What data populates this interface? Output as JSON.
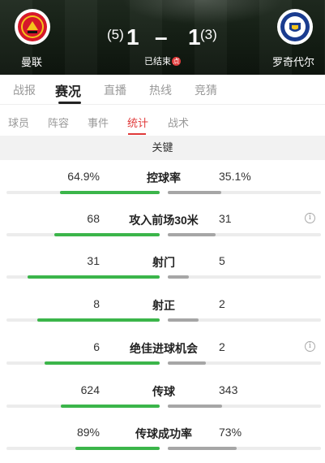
{
  "match": {
    "home": {
      "name": "曼联",
      "goals": "1",
      "penalties": "(5)"
    },
    "away": {
      "name": "罗奇代尔",
      "goals": "1",
      "penalties": "(3)"
    },
    "dash": "–",
    "status": "已结束",
    "status_badge": "点"
  },
  "tabs": [
    {
      "label": "战报",
      "active": false
    },
    {
      "label": "赛况",
      "active": true
    },
    {
      "label": "直播",
      "active": false
    },
    {
      "label": "热线",
      "active": false
    },
    {
      "label": "竞猜",
      "active": false
    }
  ],
  "subtabs": [
    {
      "label": "球员",
      "active": false
    },
    {
      "label": "阵容",
      "active": false
    },
    {
      "label": "事件",
      "active": false
    },
    {
      "label": "统计",
      "active": true
    },
    {
      "label": "战术",
      "active": false
    }
  ],
  "section_title": "关键",
  "stats": [
    {
      "label": "控球率",
      "home": "64.9%",
      "away": "35.1%",
      "home_share": 0.649,
      "away_share": 0.351,
      "info": false
    },
    {
      "label": "攻入前场30米",
      "home": "68",
      "away": "31",
      "home_share": 0.687,
      "away_share": 0.313,
      "info": true
    },
    {
      "label": "射门",
      "home": "31",
      "away": "5",
      "home_share": 0.861,
      "away_share": 0.139,
      "info": false
    },
    {
      "label": "射正",
      "home": "8",
      "away": "2",
      "home_share": 0.8,
      "away_share": 0.2,
      "info": false
    },
    {
      "label": "绝佳进球机会",
      "home": "6",
      "away": "2",
      "home_share": 0.75,
      "away_share": 0.25,
      "info": true
    },
    {
      "label": "传球",
      "home": "624",
      "away": "343",
      "home_share": 0.645,
      "away_share": 0.355,
      "info": false
    },
    {
      "label": "传球成功率",
      "home": "89%",
      "away": "73%",
      "home_share": 0.55,
      "away_share": 0.45,
      "info": false
    }
  ],
  "info_icon_glyph": "i",
  "colors": {
    "accent": "#e03a3a",
    "home_bar": "#3bb54a",
    "away_bar": "#a6a6a6"
  }
}
